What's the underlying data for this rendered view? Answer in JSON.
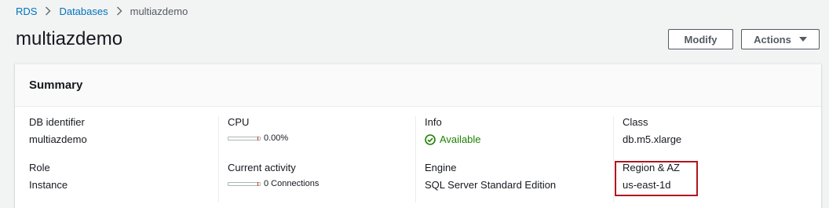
{
  "breadcrumb": {
    "items": [
      "RDS",
      "Databases"
    ],
    "current": "multiazdemo"
  },
  "header": {
    "title": "multiazdemo",
    "modify_label": "Modify",
    "actions_label": "Actions"
  },
  "summary": {
    "title": "Summary",
    "db_identifier": {
      "label": "DB identifier",
      "value": "multiazdemo"
    },
    "role": {
      "label": "Role",
      "value": "Instance"
    },
    "cpu": {
      "label": "CPU",
      "value": "0.00%"
    },
    "current_activity": {
      "label": "Current activity",
      "value": "0 Connections"
    },
    "info": {
      "label": "Info",
      "value": "Available",
      "status_color": "#1d8102"
    },
    "engine": {
      "label": "Engine",
      "value": "SQL Server Standard Edition"
    },
    "class": {
      "label": "Class",
      "value": "db.m5.xlarge"
    },
    "region_az": {
      "label": "Region & AZ",
      "value": "us-east-1d",
      "highlight_color": "#b0161e"
    }
  },
  "icons": {
    "breadcrumb_separator": "chevron-right-icon",
    "actions_caret": "caret-down-icon",
    "info_status": "check-circle-icon"
  },
  "colors": {
    "link": "#0073bb",
    "accent": "#545b64"
  }
}
